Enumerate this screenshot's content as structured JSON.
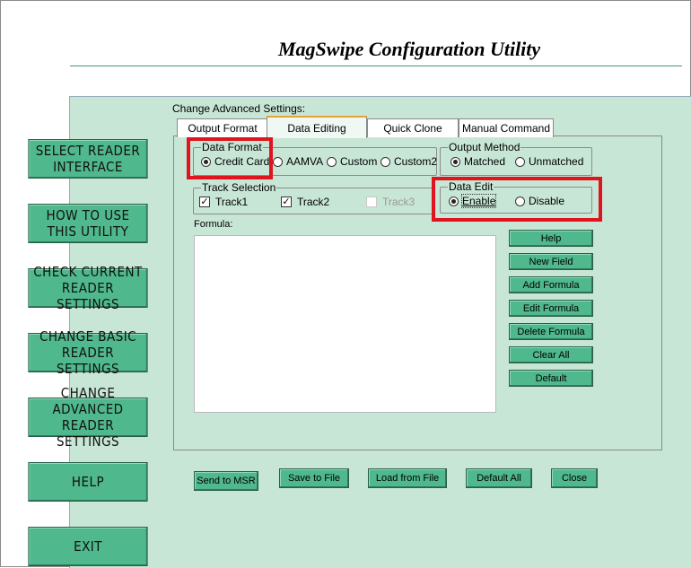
{
  "header": {
    "title": "MagSwipe Configuration Utility"
  },
  "nav": {
    "select_reader": "SELECT READER\nINTERFACE",
    "how_to_use": "HOW TO USE\nTHIS UTILITY",
    "check_current": "CHECK CURRENT\nREADER SETTINGS",
    "change_basic": "CHANGE BASIC\nREADER SETTINGS",
    "change_advanced": "CHANGE ADVANCED\nREADER SETTINGS",
    "help": "HELP",
    "exit": "EXIT"
  },
  "advanced": {
    "section_label": "Change Advanced Settings:",
    "tabs": [
      "Output Format",
      "Data Editing",
      "Quick Clone",
      "Manual Command"
    ],
    "active_tab": "Data Editing",
    "data_format": {
      "legend": "Data Format",
      "options": [
        "Credit Card",
        "AAMVA",
        "Custom",
        "Custom2"
      ],
      "selected": "Credit Card"
    },
    "output_method": {
      "legend": "Output Method",
      "options": [
        "Matched",
        "Unmatched"
      ],
      "selected": "Matched"
    },
    "track_selection": {
      "legend": "Track Selection",
      "tracks": [
        {
          "label": "Track1",
          "checked": true,
          "enabled": true
        },
        {
          "label": "Track2",
          "checked": true,
          "enabled": true
        },
        {
          "label": "Track3",
          "checked": false,
          "enabled": false
        }
      ]
    },
    "data_edit": {
      "legend": "Data Edit",
      "options": [
        "Enable",
        "Disable"
      ],
      "selected": "Enable"
    },
    "formula_label": "Formula:",
    "formula_value": "",
    "side_buttons": [
      "Help",
      "New Field",
      "Add Formula",
      "Edit Formula",
      "Delete Formula",
      "Clear All",
      "Default"
    ]
  },
  "bottom_buttons": [
    "Send to MSR",
    "Save to File",
    "Load from File",
    "Default All",
    "Close"
  ],
  "colors": {
    "button_green": "#4fb88c",
    "panel_bg": "#c8e6d6",
    "highlight_red": "#e0141e",
    "tab_accent": "#e8a23a"
  }
}
